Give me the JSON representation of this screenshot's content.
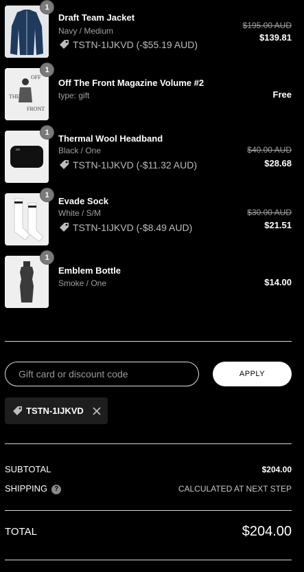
{
  "items": [
    {
      "qty": "1",
      "name": "Draft Team Jacket",
      "variant": "Navy / Medium",
      "discount": "TSTN-1IJKVD (-$55.19 AUD)",
      "old_price": "$195.00 AUD",
      "price": "$139.81"
    },
    {
      "qty": "1",
      "name": "Off The Front Magazine Volume #2",
      "variant": "type: gift",
      "price": "Free"
    },
    {
      "qty": "1",
      "name": "Thermal Wool Headband",
      "variant": "Black / One",
      "discount": "TSTN-1IJKVD (-$11.32 AUD)",
      "old_price": "$40.00 AUD",
      "price": "$28.68"
    },
    {
      "qty": "1",
      "name": "Evade Sock",
      "variant": "White / S/M",
      "discount": "TSTN-1IJKVD (-$8.49 AUD)",
      "old_price": "$30.00 AUD",
      "price": "$21.51"
    },
    {
      "qty": "1",
      "name": "Emblem Bottle",
      "variant": "Smoke / One",
      "price": "$14.00"
    }
  ],
  "discount_form": {
    "placeholder": "Gift card or discount code",
    "apply_label": "APPLY",
    "applied_code": "TSTN-1IJKVD"
  },
  "summary": {
    "subtotal_label": "SUBTOTAL",
    "subtotal_value": "$204.00",
    "shipping_label": "SHIPPING",
    "shipping_value": "CALCULATED AT NEXT STEP",
    "total_label": "TOTAL",
    "total_value": "$204.00"
  },
  "colors": {
    "background": "#000000",
    "muted_text": "#a0a0a0",
    "qty_badge": "#7a7a7a"
  }
}
